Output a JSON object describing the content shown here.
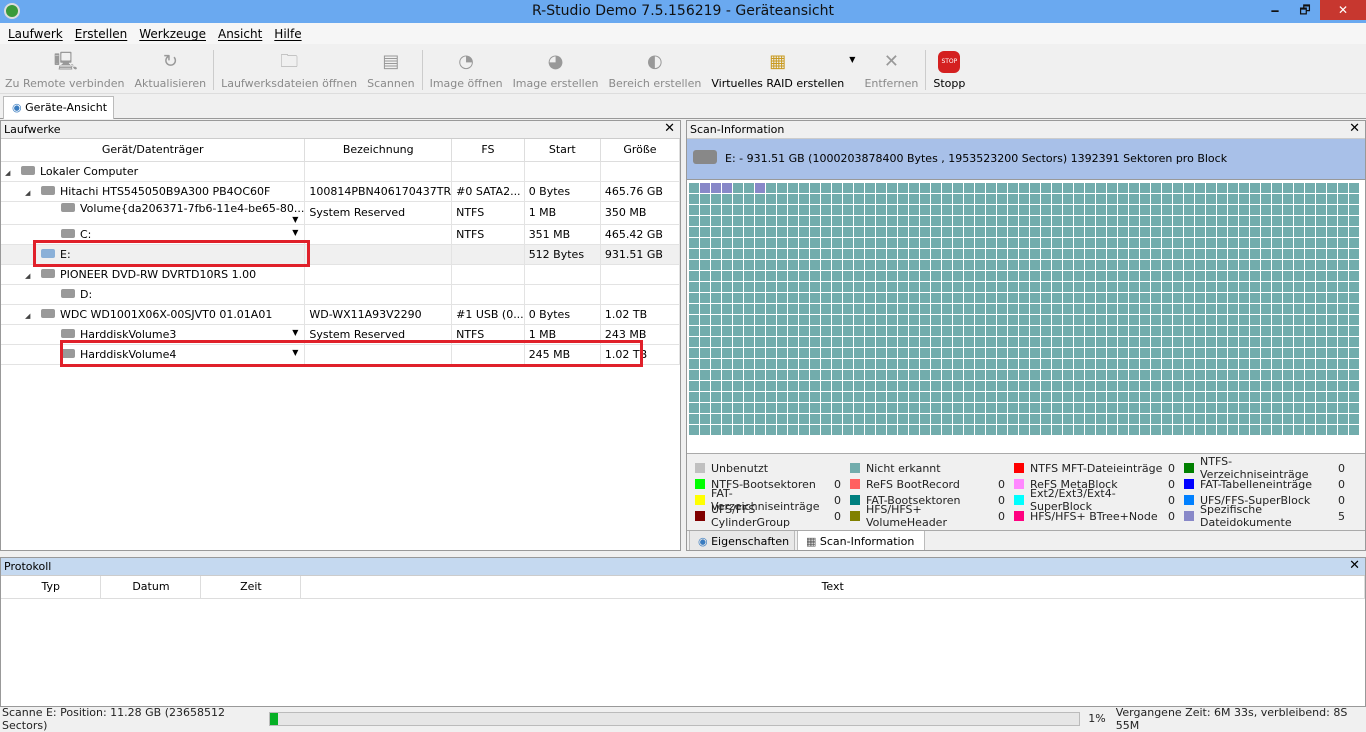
{
  "window": {
    "title": "R-Studio Demo 7.5.156219 - Geräteansicht",
    "minimize": "🗕",
    "restore": "🗗",
    "close": "✕"
  },
  "menu": [
    "Laufwerk",
    "Erstellen",
    "Werkzeuge",
    "Ansicht",
    "Hilfe"
  ],
  "toolbar": [
    {
      "label": "Zu Remote verbinden",
      "icon": "computer-icon",
      "enabled": false
    },
    {
      "label": "Aktualisieren",
      "icon": "refresh-icon",
      "enabled": false
    },
    {
      "label": "Laufwerksdateien öffnen",
      "icon": "open-files-icon",
      "enabled": false
    },
    {
      "label": "Scannen",
      "icon": "scan-icon",
      "enabled": false
    },
    {
      "label": "Image öffnen",
      "icon": "open-image-icon",
      "enabled": false
    },
    {
      "label": "Image erstellen",
      "icon": "create-image-icon",
      "enabled": false
    },
    {
      "label": "Bereich erstellen",
      "icon": "region-icon",
      "enabled": false
    },
    {
      "label": "Virtuelles RAID erstellen",
      "icon": "raid-icon",
      "enabled": true
    },
    {
      "label": "Entfernen",
      "icon": "remove-icon",
      "enabled": false
    },
    {
      "label": "Stopp",
      "icon": "stop-icon",
      "enabled": true
    }
  ],
  "stop_icon_text": "STOP",
  "main_tab": "Geräte-Ansicht",
  "drives": {
    "title": "Laufwerke",
    "columns": [
      "Gerät/Datenträger",
      "Bezeichnung",
      "FS",
      "Start",
      "Größe"
    ],
    "rows": [
      {
        "name": "Lokaler Computer",
        "label": "",
        "fs": "",
        "start": "",
        "size": "",
        "level": 0,
        "expand": "◢",
        "dd": false
      },
      {
        "name": "Hitachi HTS545050B9A300 PB4OC60F",
        "label": "100814PBN406170437TR",
        "fs": "#0 SATA2...",
        "start": "0 Bytes",
        "size": "465.76 GB",
        "level": 1,
        "expand": "◢",
        "dd": false
      },
      {
        "name": "Volume{da206371-7fb6-11e4-be65-80...",
        "label": "System Reserved",
        "fs": "NTFS",
        "start": "1 MB",
        "size": "350 MB",
        "level": 2,
        "expand": "",
        "dd": true
      },
      {
        "name": "C:",
        "label": "",
        "fs": "NTFS",
        "start": "351 MB",
        "size": "465.42 GB",
        "level": 2,
        "expand": "",
        "dd": true
      },
      {
        "name": "E:",
        "label": "",
        "fs": "",
        "start": "512 Bytes",
        "size": "931.51 GB",
        "level": 1,
        "expand": "",
        "dd": false,
        "selected": true
      },
      {
        "name": "PIONEER DVD-RW DVRTD10RS 1.00",
        "label": "",
        "fs": "",
        "start": "",
        "size": "",
        "level": 1,
        "expand": "◢",
        "dd": false
      },
      {
        "name": "D:",
        "label": "",
        "fs": "",
        "start": "",
        "size": "",
        "level": 2,
        "expand": "",
        "dd": false
      },
      {
        "name": "WDC WD1001X06X-00SJVT0 01.01A01",
        "label": "WD-WX11A93V2290",
        "fs": "#1 USB (0...",
        "start": "0 Bytes",
        "size": "1.02 TB",
        "level": 1,
        "expand": "◢",
        "dd": false
      },
      {
        "name": "HarddiskVolume3",
        "label": "System Reserved",
        "fs": "NTFS",
        "start": "1 MB",
        "size": "243 MB",
        "level": 2,
        "expand": "",
        "dd": true
      },
      {
        "name": "HarddiskVolume4",
        "label": "",
        "fs": "",
        "start": "245 MB",
        "size": "1.02 TB",
        "level": 2,
        "expand": "",
        "dd": true
      }
    ]
  },
  "scan": {
    "title": "Scan-Information",
    "info": "E: - 931.51 GB (1000203878400 Bytes , 1953523200 Sectors) 1392391 Sektoren pro Block",
    "grid_colors": {
      "default": "#72acac",
      "found": "#8888c8"
    },
    "found_blocks": [
      1,
      2,
      3,
      6
    ],
    "legend": [
      {
        "name": "Unbenutzt",
        "count": "",
        "color": "#c0c0c0"
      },
      {
        "name": "Nicht erkannt",
        "count": "",
        "color": "#72acac"
      },
      {
        "name": "NTFS MFT-Dateieinträge",
        "count": "0",
        "color": "#ff0000"
      },
      {
        "name": "NTFS-Verzeichniseinträge",
        "count": "0",
        "color": "#008000"
      },
      {
        "name": "NTFS-Bootsektoren",
        "count": "0",
        "color": "#00ff00"
      },
      {
        "name": "ReFS BootRecord",
        "count": "0",
        "color": "#ff6060"
      },
      {
        "name": "ReFS MetaBlock",
        "count": "0",
        "color": "#ff88ff"
      },
      {
        "name": "FAT-Tabelleneinträge",
        "count": "0",
        "color": "#0000ff"
      },
      {
        "name": "FAT-Verzeichniseinträge",
        "count": "0",
        "color": "#ffff00"
      },
      {
        "name": "FAT-Bootsektoren",
        "count": "0",
        "color": "#008080"
      },
      {
        "name": "Ext2/Ext3/Ext4-SuperBlock",
        "count": "0",
        "color": "#00ffff"
      },
      {
        "name": "UFS/FFS-SuperBlock",
        "count": "0",
        "color": "#0080ff"
      },
      {
        "name": "UFS/FFS CylinderGroup",
        "count": "0",
        "color": "#800000"
      },
      {
        "name": "HFS/HFS+ VolumeHeader",
        "count": "0",
        "color": "#808000"
      },
      {
        "name": "HFS/HFS+ BTree+Node",
        "count": "0",
        "color": "#ff0080"
      },
      {
        "name": "Spezifische Dateidokumente",
        "count": "5",
        "color": "#8888c8"
      }
    ],
    "tabs": [
      "Eigenschaften",
      "Scan-Information"
    ]
  },
  "log": {
    "title": "Protokoll",
    "columns": [
      "Typ",
      "Datum",
      "Zeit",
      "Text"
    ]
  },
  "status": {
    "text": "Scanne E: Position: 11.28 GB (23658512 Sectors)",
    "percent": 1,
    "percent_label": "1%",
    "time": "Vergangene Zeit: 6M 33s, verbleibend: 8S 55M"
  }
}
